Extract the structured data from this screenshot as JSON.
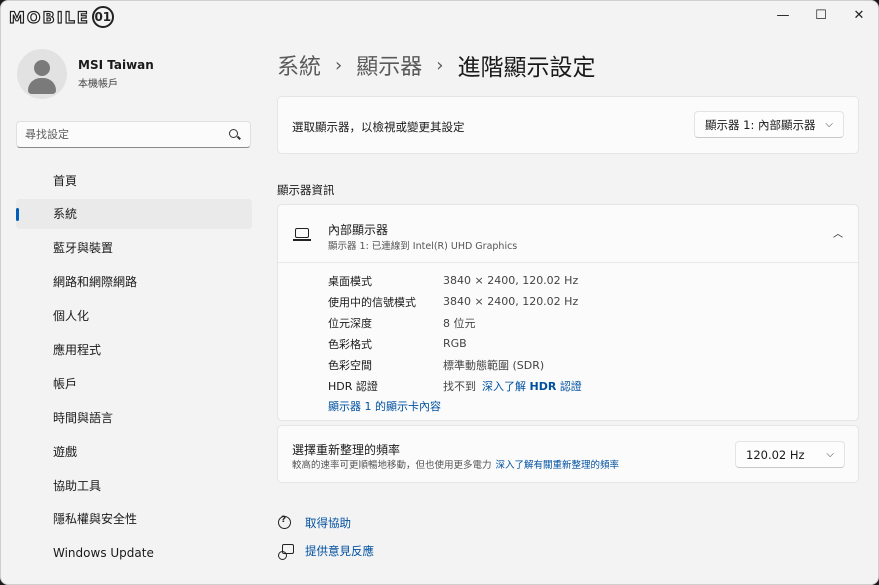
{
  "logo": {
    "text": "MOBILE",
    "badge": "01"
  },
  "window_controls": {
    "minimize": "—",
    "maximize": "☐",
    "close": "✕"
  },
  "profile": {
    "name": "MSI Taiwan",
    "account_type": "本機帳戶"
  },
  "search": {
    "placeholder": "尋找設定"
  },
  "nav": {
    "items": [
      {
        "label": "首頁"
      },
      {
        "label": "系統"
      },
      {
        "label": "藍牙與裝置"
      },
      {
        "label": "網路和網際網路"
      },
      {
        "label": "個人化"
      },
      {
        "label": "應用程式"
      },
      {
        "label": "帳戶"
      },
      {
        "label": "時間與語言"
      },
      {
        "label": "遊戲"
      },
      {
        "label": "協助工具"
      },
      {
        "label": "隱私權與安全性"
      },
      {
        "label": "Windows Update"
      }
    ],
    "active_index": 1
  },
  "breadcrumb": {
    "level1": "系統",
    "level2": "顯示器",
    "current": "進階顯示設定",
    "separator": "›"
  },
  "select_display": {
    "label": "選取顯示器，以檢視或變更其設定",
    "value": "顯示器 1: 內部顯示器"
  },
  "section_title": "顯示器資訊",
  "display_info": {
    "title": "內部顯示器",
    "subtitle": "顯示器 1: 已連線到 Intel(R) UHD Graphics",
    "rows": [
      {
        "key": "桌面模式",
        "value": "3840 × 2400, 120.02 Hz"
      },
      {
        "key": "使用中的信號模式",
        "value": "3840 × 2400, 120.02 Hz"
      },
      {
        "key": "位元深度",
        "value": "8 位元"
      },
      {
        "key": "色彩格式",
        "value": "RGB"
      },
      {
        "key": "色彩空間",
        "value": "標準動態範圍 (SDR)"
      },
      {
        "key": "HDR 認證",
        "value": "找不到",
        "link_prefix": "深入了解",
        "link_bold": "HDR",
        "link_suffix": "認證"
      }
    ],
    "adapter_link": "顯示器 1 的顯示卡內容"
  },
  "refresh": {
    "title": "選擇重新整理的頻率",
    "description": "較高的速率可更順暢地移動，但也使用更多電力",
    "learn_more": "深入了解有關重新整理的頻率",
    "value": "120.02 Hz"
  },
  "help": {
    "get_help": "取得協助",
    "feedback": "提供意見反應"
  }
}
